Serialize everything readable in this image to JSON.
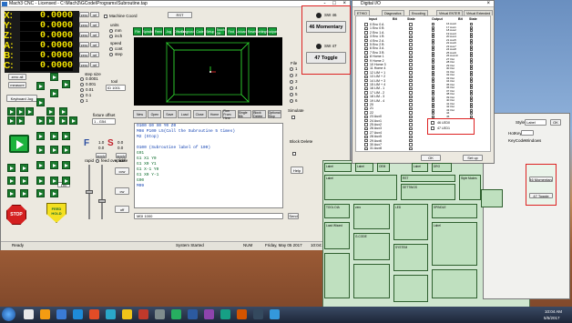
{
  "mach_window": {
    "title": "Mach3 CNC - Licensed - C:\\Mach3\\GCode\\Programs\\Subroutine.tap",
    "controls": "-  □  ×",
    "dro": [
      {
        "axis": "X:",
        "value": "0.0000"
      },
      {
        "axis": "Y:",
        "value": "0.0000"
      },
      {
        "axis": "Z:",
        "value": "0.0000"
      },
      {
        "axis": "A:",
        "value": "0.0000"
      },
      {
        "axis": "B:",
        "value": "0.0000"
      },
      {
        "axis": "C:",
        "value": "0.0000"
      }
    ],
    "zero_label": "zero",
    "ref_label": "ref",
    "machine_coord": "Machine Coord",
    "rst_label": "RST",
    "units_label": "units",
    "units_options": [
      "mm",
      "inch"
    ],
    "speed_label": "speed",
    "speed_options": [
      "cont",
      "step"
    ],
    "zero_all": "zero all",
    "measure": "measure",
    "keyboard_jog": "Keyboard Jog",
    "step_size_label": "step size",
    "step_options": [
      "0.0001",
      "0.001",
      "0.01",
      "0.1",
      "1"
    ],
    "tool_label": "tool",
    "tool_value": "ID 1001",
    "fixture_label": "fixture offset",
    "fixture_value": "1 - G54",
    "f_label": "F",
    "s_label": "S",
    "f_values": [
      "1.0",
      "0.0"
    ],
    "s_values": [
      "0.0",
      "0.0"
    ],
    "spindle_label": "spindle",
    "apply": "apply",
    "rapid_label": "rapid",
    "feed_override": "feed override",
    "jog_percent": "100",
    "ccw": "ccw",
    "cw": "cw",
    "off": "off",
    "stop": "STOP",
    "feed_hold": "FEED HOLD",
    "toolbar": [
      "File",
      "Spindle",
      "Feed",
      "Jog",
      "Offsets",
      "Diagnostics",
      "Code",
      "Setup",
      "Touch Off",
      "Find",
      "Unload",
      "Reset",
      "Settings",
      "Toolpath"
    ],
    "file_label": "File",
    "file_options": [
      "1",
      "2",
      "3",
      "4",
      "5",
      "6"
    ],
    "gcode_tabs": [
      "New",
      "Open",
      "Save",
      "Load",
      "Close",
      "Home",
      "Run From Here",
      "Single Blk",
      "Block Delete",
      "Optional Stop"
    ],
    "gcode_lines": [
      "O100 G0 X0 Y0 Z0",
      "M98 P100 L5(Call the Subroutine 5 times)",
      "M2 (Stop)",
      "",
      "O100 (Subroutine label of 100)",
      "G91",
      "G1 X1 Y0",
      "G1 X0 Y1",
      "G1 X-1 Y0",
      "G1 X0 Y-1",
      "G90",
      "M99"
    ],
    "simulate": "Simulate",
    "block_delete": "Block Delete",
    "help": "Help",
    "mdi_value": "MDI 1000",
    "send": "Send",
    "status_ready": "Ready",
    "status_started": "System Started",
    "status_num": "NUM",
    "status_date": "Friday, May 05 2017",
    "status_time": "10:04:35 AM"
  },
  "toggle_panel": {
    "items": [
      {
        "id": "SW 46",
        "label": "46 Momentary"
      },
      {
        "id": "SW 47",
        "label": "47 Toggle"
      }
    ]
  },
  "digital_io": {
    "title": "Digital I/O",
    "tabs": [
      "ETHIO",
      "Diagnostics",
      "Encoding",
      "Virtual ENTER",
      "Virtual Extended"
    ],
    "headers": [
      "Input",
      "Bit",
      "State",
      "Output",
      "Bit",
      "State"
    ],
    "inputs": [
      "0 Enc 0 A",
      "1 Enc 0 B",
      "2 Enc 1 A",
      "3 Enc 1 B",
      "4 Enc 2 A",
      "5 Enc 2 B",
      "6 Enc 3 A",
      "7 Enc 3 B",
      "8 Home 1",
      "9 Home 2",
      "10 Home 3",
      "11 Home 4",
      "12 LIM + 1",
      "13 LIM + 2",
      "14 LIM + 3",
      "15 LIM + 4",
      "16 LIM - 1",
      "17 LIM - 2",
      "18 LIM - 3",
      "19 LIM - 4",
      "20",
      "21",
      "22",
      "23 Aux0",
      "24 Aux1",
      "25 Aux2",
      "26 Aux3",
      "27 Aux4",
      "28 Aux5",
      "29 Aux6",
      "30 Aux7",
      "31 Aux8"
    ],
    "outputs": [
      "16 Aux0",
      "17 Aux1",
      "18 Aux2",
      "19 Aux3",
      "20 Aux4",
      "21 Aux5",
      "22 Aux6",
      "23 Aux7",
      "24 Aux8",
      "25 Aux9",
      "26 Aux10",
      "27 Out",
      "28 Out",
      "29 Out",
      "30 Out",
      "31 Out",
      "32 Out",
      "33 Out",
      "34 Out",
      "35 Out",
      "36 Out",
      "37 Out",
      "38 Out",
      "39 Out",
      "40 Out",
      "41 Out",
      "42 Out",
      "43 Out",
      "44",
      "45"
    ],
    "highlight_outputs": [
      "46 LED0",
      "47 LED1"
    ],
    "ok": "OK",
    "setup": "Set up"
  },
  "screen_designer": {
    "style_label": "Style",
    "style_value": "Label",
    "ok_label": "OK",
    "hot_key_label": "HotKey",
    "key_code_label": "KeyCode",
    "key_code_value": "Windows",
    "side_buttons": [
      "46 Momentary",
      "47 Toggle"
    ],
    "labels": [
      "Label",
      "Label",
      "OEM",
      "Label",
      "DRO",
      "Label",
      "RST",
      "SETTINGS",
      "Style Modes",
      "TOOL DIA",
      "zero",
      "LED",
      "SPINDLE",
      "Load Wizard",
      "G-CODE",
      "SYSTEM",
      "Label"
    ]
  },
  "taskbar": {
    "time": "10:04 AM",
    "date": "5/5/2017",
    "start": "start"
  }
}
